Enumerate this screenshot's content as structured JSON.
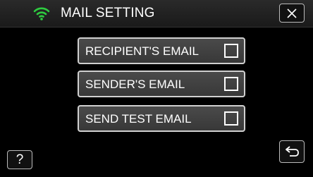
{
  "header": {
    "title": "MAIL SETTING",
    "wifi_icon": "wifi-icon",
    "close_icon": "close-icon",
    "accent_color": "#2ecc40"
  },
  "options": [
    {
      "label": "RECIPIENT'S EMAIL",
      "checked": false
    },
    {
      "label": "SENDER'S EMAIL",
      "checked": false
    },
    {
      "label": "SEND TEST EMAIL",
      "checked": false
    }
  ],
  "footer": {
    "help_label": "?",
    "back_icon": "return-icon"
  }
}
